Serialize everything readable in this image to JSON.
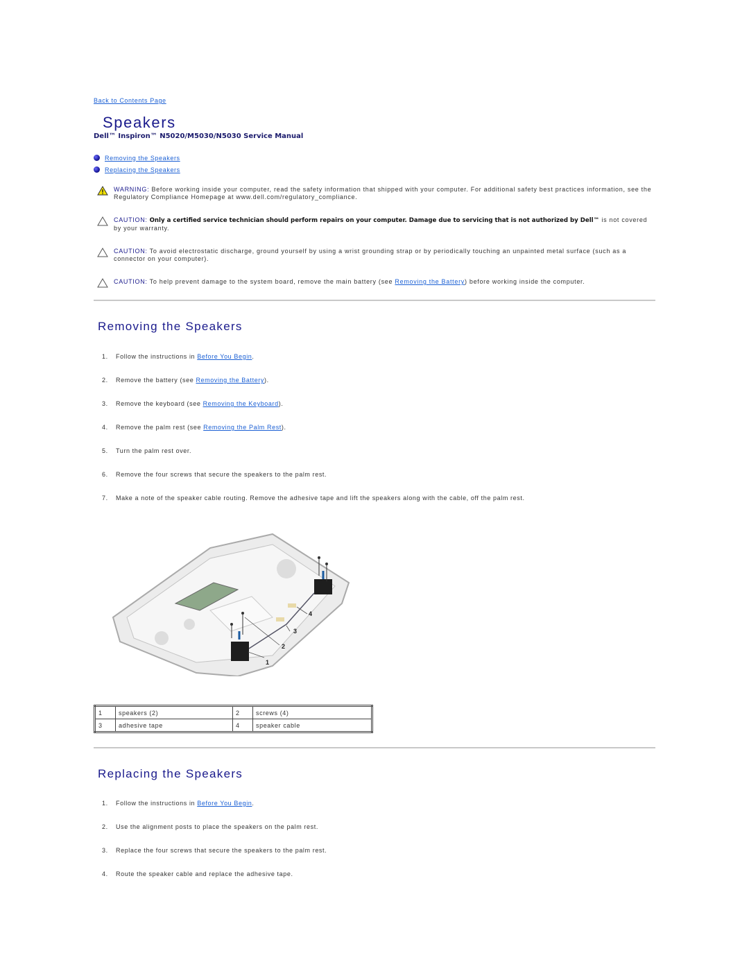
{
  "nav": {
    "back_link": "Back to Contents Page"
  },
  "header": {
    "title": "Speakers",
    "subtitle": "Dell™ Inspiron™ N5020/M5030/N5030 Service Manual"
  },
  "toc": [
    {
      "label": "Removing the Speakers"
    },
    {
      "label": "Replacing the Speakers"
    }
  ],
  "notices": [
    {
      "type": "warning",
      "icon": "warning-icon",
      "label": "WARNING:",
      "text": " Before working inside your computer, read the safety information that shipped with your computer. For additional safety best practices information, see the Regulatory Compliance Homepage at www.dell.com/regulatory_compliance."
    },
    {
      "type": "caution",
      "icon": "caution-icon",
      "label": "CAUTION:",
      "bold": " Only a certified service technician should perform repairs on your computer. Damage due to servicing that is not authorized by Dell™",
      "text": " is not covered by your warranty."
    },
    {
      "type": "caution",
      "icon": "caution-icon",
      "label": "CAUTION:",
      "text": " To avoid electrostatic discharge, ground yourself by using a wrist grounding strap or by periodically touching an unpainted metal surface (such as a connector on your computer)."
    },
    {
      "type": "caution",
      "icon": "caution-icon",
      "label": "CAUTION:",
      "pre": " To help prevent damage to the system board, remove the main battery (see ",
      "link": "Removing the Battery",
      "post": ") before working inside the computer."
    }
  ],
  "removing": {
    "heading": "Removing the Speakers",
    "steps": [
      {
        "num": "1.",
        "pre": "Follow the instructions in ",
        "link": "Before You Begin",
        "post": "."
      },
      {
        "num": "2.",
        "pre": "Remove the battery (see ",
        "link": "Removing the Battery",
        "post": ")."
      },
      {
        "num": "3.",
        "pre": "Remove the keyboard (see ",
        "link": "Removing the Keyboard",
        "post": ")."
      },
      {
        "num": "4.",
        "pre": "Remove the palm rest (see ",
        "link": "Removing the Palm Rest",
        "post": ")."
      },
      {
        "num": "5.",
        "pre": "Turn the palm rest over."
      },
      {
        "num": "6.",
        "pre": "Remove the four screws that secure the speakers to the palm rest."
      },
      {
        "num": "7.",
        "pre": "Make a note of the speaker cable routing. Remove the adhesive tape and lift the speakers along with the cable, off the palm rest."
      }
    ],
    "figure_callouts": [
      "1",
      "2",
      "3",
      "4"
    ],
    "legend": [
      [
        {
          "num": "1",
          "label": "speakers (2)"
        },
        {
          "num": "2",
          "label": "screws (4)"
        }
      ],
      [
        {
          "num": "3",
          "label": "adhesive tape"
        },
        {
          "num": "4",
          "label": "speaker cable"
        }
      ]
    ]
  },
  "replacing": {
    "heading": "Replacing the Speakers",
    "steps": [
      {
        "num": "1.",
        "pre": "Follow the instructions in ",
        "link": "Before You Begin",
        "post": "."
      },
      {
        "num": "2.",
        "pre": "Use the alignment posts to place the speakers on the palm rest."
      },
      {
        "num": "3.",
        "pre": "Replace the four screws that secure the speakers to the palm rest."
      },
      {
        "num": "4.",
        "pre": "Route the speaker cable and replace the adhesive tape."
      }
    ]
  }
}
